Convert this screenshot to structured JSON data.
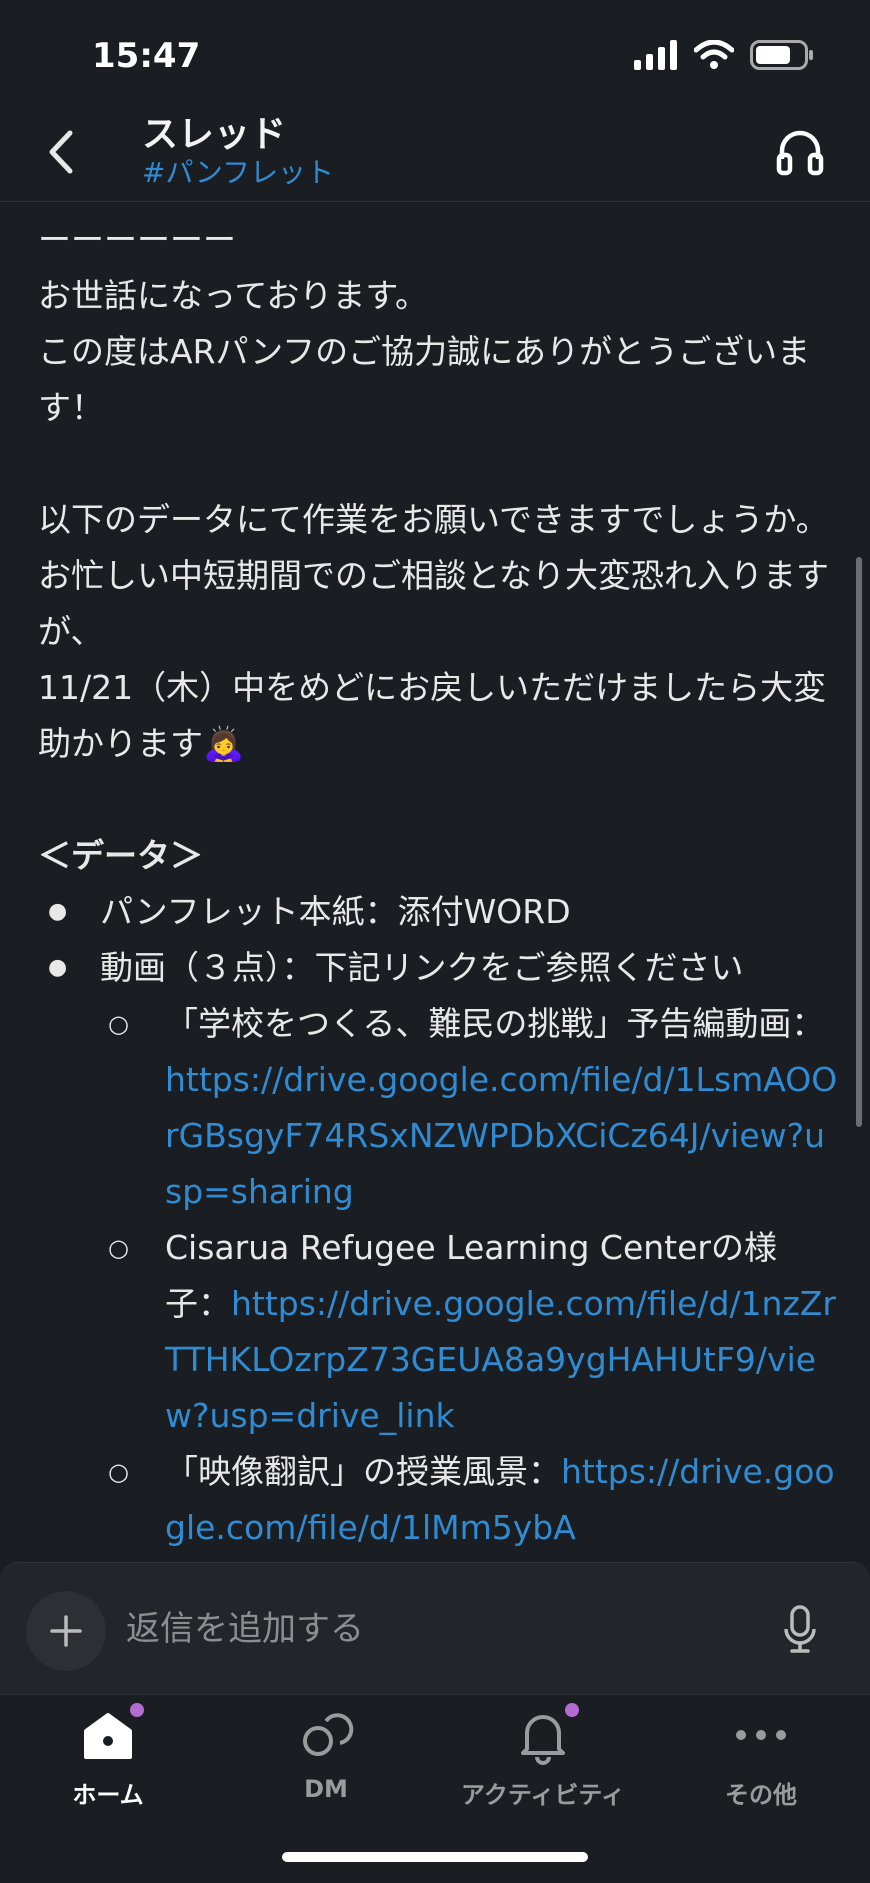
{
  "status": {
    "time": "15:47"
  },
  "header": {
    "title": "スレッド",
    "channel": "#パンフレット"
  },
  "message": {
    "divider": "ーーーーーー",
    "greeting": "お世話になっております。",
    "thanks": "この度はARパンフのご協力誠にありがとうございます！",
    "request": "以下のデータにて作業をお願いできますでしょうか。",
    "apology": "お忙しい中短期間でのご相談となり大変恐れ入りますが、",
    "deadline": "11/21（木）中をめどにお戻しいただけましたら大変助かります🙇‍♀️",
    "data_heading": "＜データ＞",
    "items": [
      {
        "text": "パンフレット本紙：添付WORD"
      },
      {
        "text": "動画（３点）：下記リンクをご参照ください"
      }
    ],
    "sub_items": [
      {
        "label": "「学校をつくる、難民の挑戦」予告編動画：",
        "link": "https://drive.google.com/file/d/1LsmAOOrGBsgyF74RSxNZWPDbXCiCz64J/view?usp=sharing"
      },
      {
        "label": "Cisarua Refugee Learning Centerの様子：",
        "link": "https://drive.google.com/file/d/1nzZrTTHKLOzrpZ73GEUA8a9ygHAHUtF9/view?usp=drive_link"
      },
      {
        "label": "「映像翻訳」の授業風景：",
        "link": "https://drive.google.com/file/d/1lMm5ybA"
      }
    ]
  },
  "composer": {
    "placeholder": "返信を追加する"
  },
  "tabs": [
    {
      "label": "ホーム",
      "icon": "home-icon",
      "active": true,
      "badge": true
    },
    {
      "label": "DM",
      "icon": "dm-icon",
      "active": false,
      "badge": false
    },
    {
      "label": "アクティビティ",
      "icon": "bell-icon",
      "active": false,
      "badge": true
    },
    {
      "label": "その他",
      "icon": "more-icon",
      "active": false,
      "badge": false
    }
  ],
  "colors": {
    "background": "#1a1d21",
    "link": "#2f8bd2",
    "badge": "#b36bd1"
  }
}
